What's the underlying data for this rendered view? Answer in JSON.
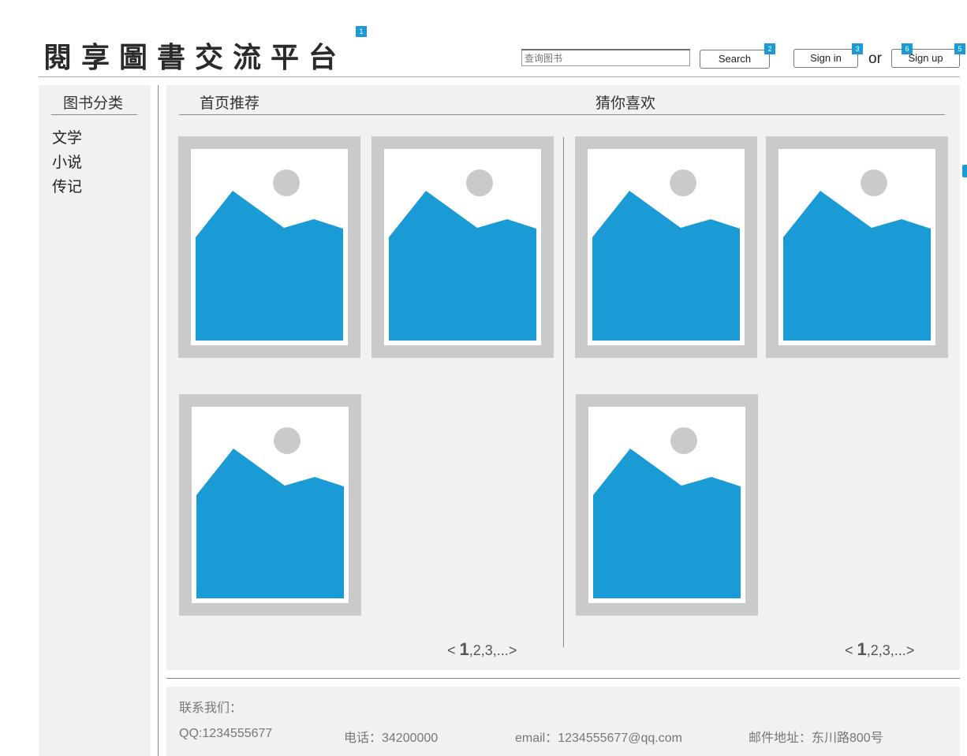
{
  "header": {
    "logo_text": "閱享圖書交流平台",
    "search_placeholder": "查询图书",
    "search_label": "Search",
    "signin_label": "Sign in",
    "or_text": "or",
    "signup_label": "Sign up",
    "badges": [
      "1",
      "2",
      "3",
      "6",
      "5"
    ]
  },
  "sidebar": {
    "title": "图书分类",
    "categories": [
      "文学",
      "小说",
      "传记"
    ]
  },
  "main": {
    "recommend_title": "首页推荐",
    "guess_title": "猜你喜欢",
    "recommend_pager": {
      "prev": "<",
      "current": "1",
      "rest": ",2,3,...",
      "next": ">"
    },
    "guess_pager": {
      "prev": "<",
      "current": "1",
      "rest": ",2,3,...",
      "next": ">"
    },
    "image_colors": {
      "frame": "#cacaca",
      "sky": "#ffffff",
      "mountain": "#1a9bd6",
      "sun": "#cacaca"
    }
  },
  "footer": {
    "contact_label": "联系我们：",
    "qq": "QQ:1234555677",
    "phone": "电话：34200000",
    "email": "email：1234555677@qq.com",
    "address": "邮件地址：东川路800号"
  }
}
